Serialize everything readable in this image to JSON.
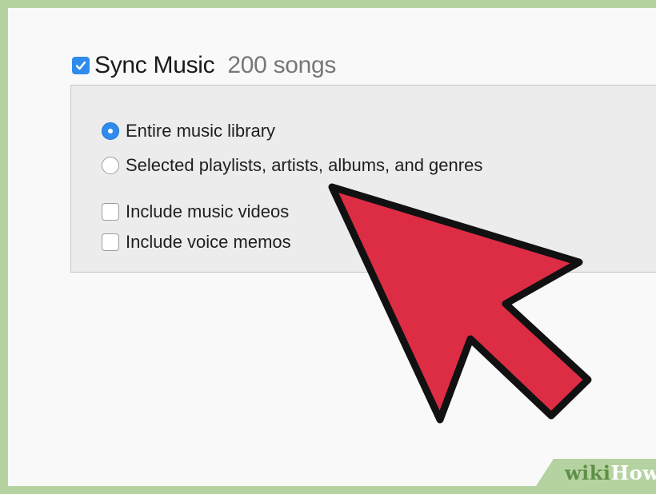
{
  "sync": {
    "checked": true,
    "label": "Sync Music",
    "count": "200 songs"
  },
  "options": {
    "entire_library": {
      "label": "Entire music library",
      "selected": true
    },
    "selected_items": {
      "label": "Selected playlists, artists, albums, and genres",
      "selected": false
    },
    "include_videos": {
      "label": "Include music videos",
      "checked": false
    },
    "include_memos": {
      "label": "Include voice memos",
      "checked": false
    }
  },
  "pointer": {
    "icon": "arrow-pointer-icon",
    "color": "#dc2d45"
  },
  "watermark": {
    "wiki": "wiki",
    "how": "How"
  },
  "colors": {
    "accent": "#2f8cec",
    "frame": "#b5d3a0",
    "arrow": "#dc2d45"
  }
}
